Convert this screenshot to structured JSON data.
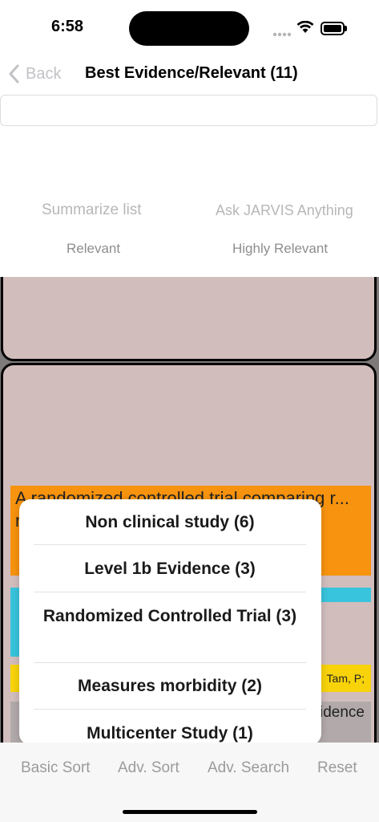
{
  "status_bar": {
    "time": "6:58"
  },
  "nav": {
    "back_label": "Back",
    "title": "Best Evidence/Relevant (11)"
  },
  "search": {
    "placeholder": ""
  },
  "actions": {
    "summarize": "Summarize list",
    "ask": "Ask JARVIS Anything"
  },
  "filters": {
    "relevant": "Relevant",
    "highly_relevant": "Highly Relevant"
  },
  "article": {
    "title_partial": "A randomized controlled trial comparing r... ments ...MP3",
    "authors_partial": "Tam, P;",
    "evidence_partial": "y, ... idence"
  },
  "popover": {
    "items": [
      {
        "label": "Non clinical study (6)"
      },
      {
        "label": "Level 1b Evidence (3)"
      },
      {
        "label": "Randomized Controlled Trial (3)"
      },
      {
        "label": "Measures morbidity (2)"
      },
      {
        "label": "Multicenter Study (1)"
      }
    ]
  },
  "toolbar": {
    "basic_sort": "Basic Sort",
    "adv_sort": "Adv. Sort",
    "adv_search": "Adv. Search",
    "reset": "Reset"
  },
  "colors": {
    "card": "#d2bdbd",
    "orange": "#f7930e",
    "cyan": "#38c4dc",
    "yellow": "#f8d30a"
  }
}
